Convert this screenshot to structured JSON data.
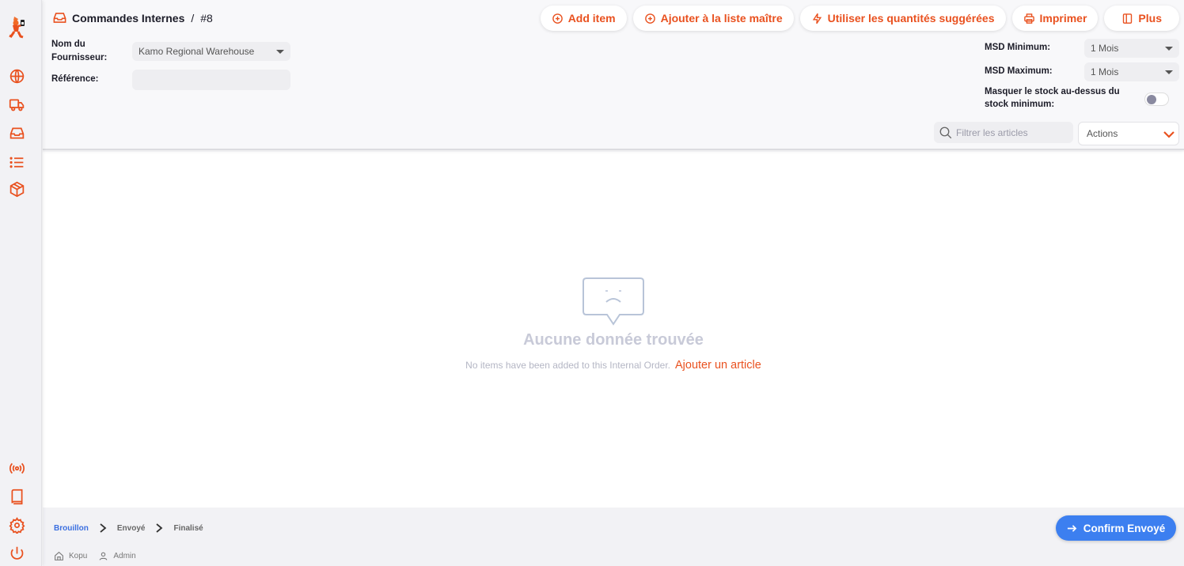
{
  "header": {
    "section": "Commandes Internes",
    "separator": "/",
    "record": "#8"
  },
  "toolbar": {
    "add_item": "Add item",
    "add_to_master": "Ajouter à la liste maître",
    "use_suggested": "Utiliser les quantités suggérées",
    "print": "Imprimer",
    "more": "Plus"
  },
  "form": {
    "supplier_label": "Nom du Fournisseur:",
    "supplier_label_line1": "Nom du",
    "supplier_label_line2": "Fournisseur:",
    "supplier_value": "Kamo Regional Warehouse",
    "reference_label": "Référence:",
    "reference_value": "",
    "msd_min_label": "MSD Minimum:",
    "msd_min_value": "1 Mois",
    "msd_max_label": "MSD Maximum:",
    "msd_max_value": "1 Mois",
    "hide_stock_label_line1": "Masquer le stock au-dessus du",
    "hide_stock_label_line2": "stock minimum:",
    "hide_stock_toggle": false,
    "filter_placeholder": "Filtrer les articles",
    "actions_label": "Actions"
  },
  "empty_state": {
    "title": "Aucune donnée trouvée",
    "message": "No items have been added to this Internal Order.",
    "link": "Ajouter un article"
  },
  "footer": {
    "steps": [
      "Brouillon",
      "Envoyé",
      "Finalisé"
    ],
    "active_step": "Brouillon",
    "store": "Kopu",
    "user": "Admin",
    "confirm_label": "Confirm Envoyé"
  },
  "sidebar": {
    "top_items": [
      "globe-icon",
      "truck-icon",
      "inbox-icon",
      "list-icon",
      "box-icon"
    ],
    "bottom_items": [
      "broadcast-icon",
      "book-icon",
      "gear-icon",
      "power-icon"
    ]
  },
  "colors": {
    "accent": "#e9511f",
    "primary_blue": "#3c7ff0",
    "active_step": "#3b6fe0"
  }
}
